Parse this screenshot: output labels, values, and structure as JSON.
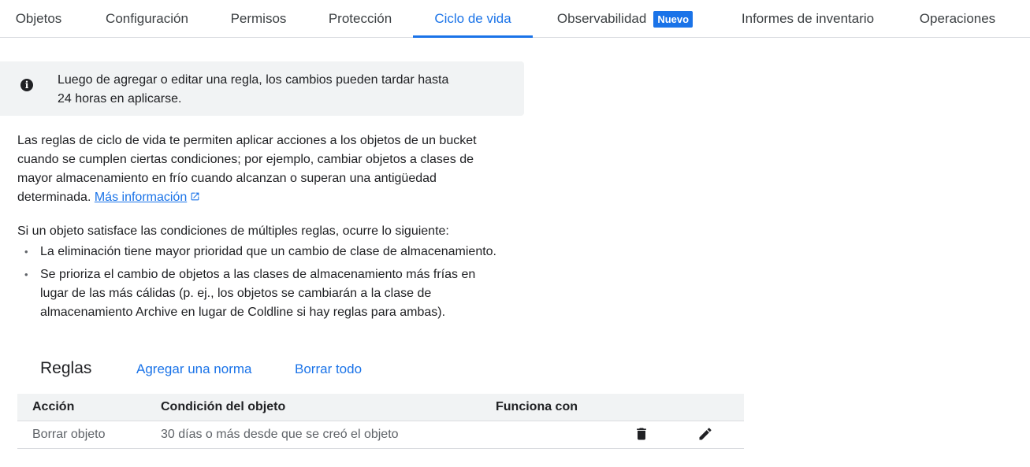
{
  "tabs": [
    {
      "label": "Objetos"
    },
    {
      "label": "Configuración"
    },
    {
      "label": "Permisos"
    },
    {
      "label": "Protección"
    },
    {
      "label": "Ciclo de vida",
      "active": true
    },
    {
      "label": "Observabilidad",
      "badge": "Nuevo"
    },
    {
      "label": "Informes de inventario"
    },
    {
      "label": "Operaciones"
    }
  ],
  "info_banner": {
    "icon": "info-icon",
    "line1": "Luego de agregar o editar una regla, los cambios pueden tardar hasta",
    "line2": "24 horas en aplicarse."
  },
  "intro": {
    "text": "Las reglas de ciclo de vida te permiten aplicar acciones a los objetos de un bucket cuando se cumplen ciertas condiciones; por ejemplo, cambiar objetos a clases de mayor almacenamiento en frío cuando alcanzan o superan una antigüedad determinada.",
    "link_label": "Más información",
    "link_icon": "external-link-icon"
  },
  "multi_rules": {
    "heading": "Si un objeto satisface las condiciones de múltiples reglas, ocurre lo siguiente:",
    "items": [
      "La eliminación tiene mayor prioridad que un cambio de clase de almacenamiento.",
      "Se prioriza el cambio de objetos a las clases de almacenamiento más frías en lugar de las más cálidas (p. ej., los objetos se cambiarán a la clase de almacenamiento Archive en lugar de Coldline si hay reglas para ambas)."
    ]
  },
  "rules_section": {
    "title": "Reglas",
    "add_label": "Agregar una norma",
    "clear_label": "Borrar todo"
  },
  "table": {
    "headers": [
      "Acción",
      "Condición del objeto",
      "Funciona con"
    ],
    "rows": [
      {
        "action": "Borrar objeto",
        "condition": "30 días o más desde que se creó el objeto",
        "works_with": ""
      }
    ]
  },
  "colors": {
    "accent": "#1a73e8",
    "banner_bg": "#f1f3f4",
    "text": "#202124",
    "muted": "#5f6368"
  }
}
